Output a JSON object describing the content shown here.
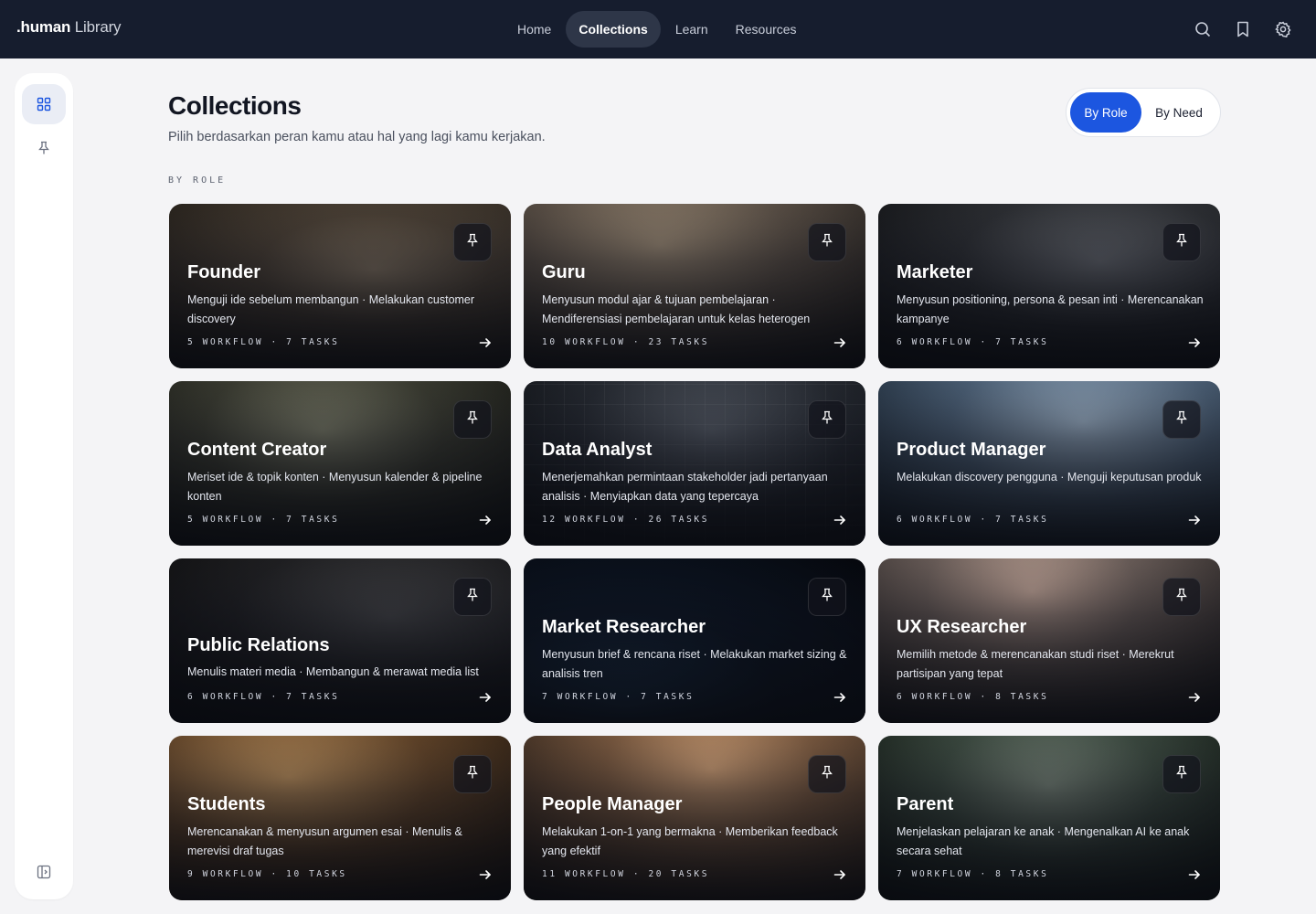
{
  "app": {
    "logo_prefix": ".human",
    "logo_suffix": " Library"
  },
  "nav": [
    {
      "label": "Home",
      "active": false
    },
    {
      "label": "Collections",
      "active": true
    },
    {
      "label": "Learn",
      "active": false
    },
    {
      "label": "Resources",
      "active": false
    }
  ],
  "top_icons": [
    "search-icon",
    "bookmark-icon",
    "settings-icon"
  ],
  "sidebar": {
    "items": [
      "grid-icon",
      "pin-icon"
    ],
    "footer": "sidebar-toggle-icon"
  },
  "header": {
    "title": "Collections",
    "subtitle": "Pilih berdasarkan peran kamu atau hal yang lagi kamu kerjakan.",
    "toggle": {
      "active_label": "By Role",
      "inactive_label": "By Need"
    },
    "section_label": "BY ROLE"
  },
  "colors": {
    "accent": "#1c56e0",
    "topbar": "#161d2e"
  },
  "cards": [
    {
      "title": "Founder",
      "description": "Menguji ide sebelum membangun · Melakukan customer discovery",
      "meta": "5 WORKFLOW · 7 TASKS",
      "theme": "warm-brown"
    },
    {
      "title": "Guru",
      "description": "Menyusun modul ajar & tujuan pembelajaran · Mendiferensiasi pembelajaran untuk kelas heterogen",
      "meta": "10 WORKFLOW · 23 TASKS",
      "theme": "sepia"
    },
    {
      "title": "Marketer",
      "description": "Menyusun positioning, persona & pesan inti · Merencanakan kampanye",
      "meta": "6 WORKFLOW · 7 TASKS",
      "theme": "mono-dark"
    },
    {
      "title": "Content Creator",
      "description": "Meriset ide & topik konten · Menyusun kalender & pipeline konten",
      "meta": "5 WORKFLOW · 7 TASKS",
      "theme": "olive"
    },
    {
      "title": "Data Analyst",
      "description": "Menerjemahkan permintaan stakeholder jadi pertanyaan analisis · Menyiapkan data yang tepercaya",
      "meta": "12 WORKFLOW · 26 TASKS",
      "theme": "slate-grid"
    },
    {
      "title": "Product Manager",
      "description": "Melakukan discovery pengguna · Menguji keputusan produk",
      "meta": "6 WORKFLOW · 7 TASKS",
      "theme": "steel-blue"
    },
    {
      "title": "Public Relations",
      "description": "Menulis materi media · Membangun & merawat media list",
      "meta": "6 WORKFLOW · 7 TASKS",
      "theme": "charcoal"
    },
    {
      "title": "Market Researcher",
      "description": "Menyusun brief & rencana riset · Melakukan market sizing & analisis tren",
      "meta": "7 WORKFLOW · 7 TASKS",
      "theme": "night"
    },
    {
      "title": "UX Researcher",
      "description": "Memilih metode & merencanakan studi riset · Merekrut partisipan yang tepat",
      "meta": "6 WORKFLOW · 8 TASKS",
      "theme": "warm-grey"
    },
    {
      "title": "Students",
      "description": "Merencanakan & menyusun argumen esai · Menulis & merevisi draf tugas",
      "meta": "9 WORKFLOW · 10 TASKS",
      "theme": "amber"
    },
    {
      "title": "People Manager",
      "description": "Melakukan 1-on-1 yang bermakna · Memberikan feedback yang efektif",
      "meta": "11 WORKFLOW · 20 TASKS",
      "theme": "chess"
    },
    {
      "title": "Parent",
      "description": "Menjelaskan pelajaran ke anak · Mengenalkan AI ke anak secara sehat",
      "meta": "7 WORKFLOW · 8 TASKS",
      "theme": "forest"
    }
  ]
}
